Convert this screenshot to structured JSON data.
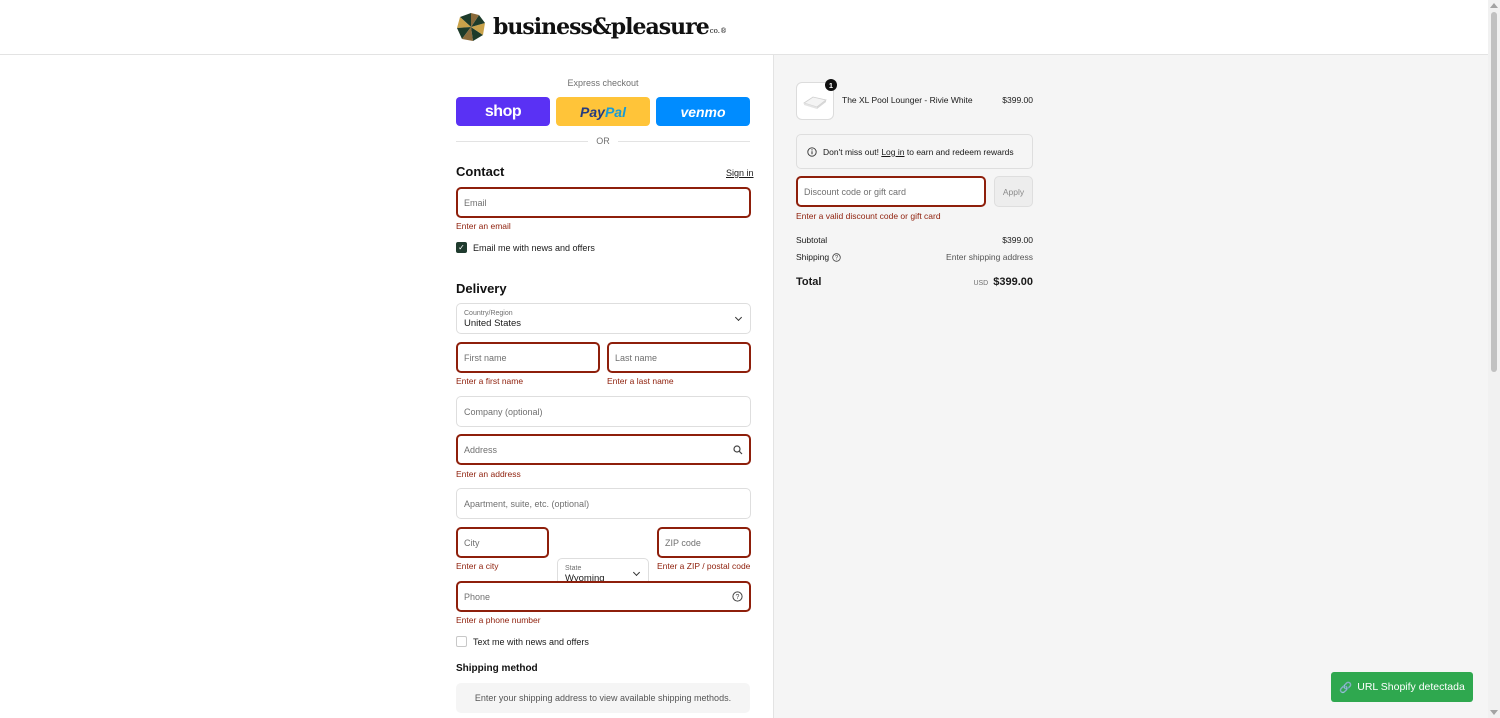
{
  "header": {
    "logo_text": "business&pleasure",
    "logo_suffix": "co.®"
  },
  "express": {
    "label": "Express checkout",
    "shop_label": "shop",
    "paypal_part1": "Pay",
    "paypal_part2": "Pal",
    "venmo_label": "venmo",
    "or_label": "OR"
  },
  "contact": {
    "title": "Contact",
    "sign_in": "Sign in",
    "email_placeholder": "Email",
    "email_error": "Enter an email",
    "newsletter_label": "Email me with news and offers",
    "newsletter_checked": true
  },
  "delivery": {
    "title": "Delivery",
    "country_label": "Country/Region",
    "country_value": "United States",
    "first_name_placeholder": "First name",
    "first_name_error": "Enter a first name",
    "last_name_placeholder": "Last name",
    "last_name_error": "Enter a last name",
    "company_placeholder": "Company (optional)",
    "address_placeholder": "Address",
    "address_error": "Enter an address",
    "apartment_placeholder": "Apartment, suite, etc. (optional)",
    "city_placeholder": "City",
    "city_error": "Enter a city",
    "state_label": "State",
    "state_value": "Wyoming",
    "zip_placeholder": "ZIP code",
    "zip_error": "Enter a ZIP / postal code",
    "phone_placeholder": "Phone",
    "phone_error": "Enter a phone number",
    "sms_label": "Text me with news and offers",
    "sms_checked": false
  },
  "shipping_method": {
    "title": "Shipping method",
    "message": "Enter your shipping address to view available shipping methods."
  },
  "order": {
    "product_name": "The XL Pool Lounger - Rivie White",
    "product_price": "$399.00",
    "quantity": "1",
    "rewards_prefix": "Don't miss out!",
    "rewards_link": "Log in",
    "rewards_suffix": "to earn and redeem rewards",
    "discount_placeholder": "Discount code or gift card",
    "discount_error": "Enter a valid discount code or gift card",
    "apply_label": "Apply",
    "subtotal_label": "Subtotal",
    "subtotal_value": "$399.00",
    "shipping_label": "Shipping",
    "shipping_value": "Enter shipping address",
    "total_label": "Total",
    "currency": "USD",
    "total_value": "$399.00"
  },
  "extension": {
    "shopify_label": "URL Shopify detectada"
  },
  "colors": {
    "error": "#8e1f0b",
    "shop_purple": "#5a31f4",
    "paypal_yellow": "#ffc439",
    "venmo_blue": "#008cff",
    "extension_green": "#2fa84f"
  }
}
